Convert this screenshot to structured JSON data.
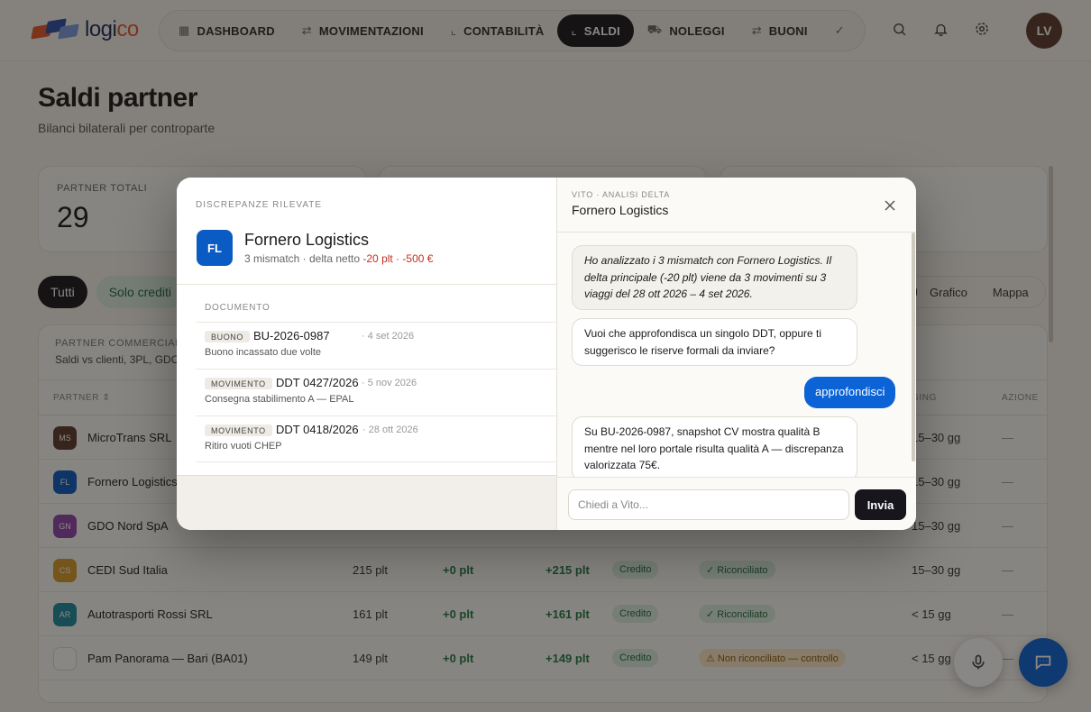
{
  "app": {
    "logo_main": "logi",
    "logo_accent": "co",
    "user_initials": "LV"
  },
  "nav": [
    {
      "label": "DASHBOARD",
      "icon": "grid-icon"
    },
    {
      "label": "MOVIMENTAZIONI",
      "icon": "swap-icon"
    },
    {
      "label": "CONTABILITÀ",
      "icon": "chart-icon"
    },
    {
      "label": "SALDI",
      "icon": "chart-icon",
      "active": true
    },
    {
      "label": "NOLEGGI",
      "icon": "truck-icon"
    },
    {
      "label": "BUONI",
      "icon": "swap-icon"
    }
  ],
  "page": {
    "title": "Saldi partner",
    "subtitle": "Bilanci bilaterali per controparte"
  },
  "stats": [
    {
      "label": "PARTNER TOTALI",
      "value": "29"
    }
  ],
  "filters": {
    "all": "Tutti",
    "credit_only": "Solo crediti",
    "view_chart": "Grafico",
    "view_map": "Mappa"
  },
  "table": {
    "title": "PARTNER COMMERCIALI",
    "subtitle": "Saldi vs clienti, 3PL, GDO",
    "col_partner": "PARTNER ⇕",
    "col_aging": "GING",
    "col_action": "AZIONE",
    "rows": [
      {
        "initials": "MS",
        "color": "#5b3b2f",
        "name": "MicroTrans SRL",
        "saldo": "",
        "delta": "",
        "netto": "",
        "type": "",
        "status": "",
        "status_kind": "",
        "aging": "15–30 gg",
        "azione": "—"
      },
      {
        "initials": "FL",
        "color": "#0a5bc4",
        "name": "Fornero Logistics",
        "saldo": "",
        "delta": "",
        "netto": "",
        "type": "",
        "status": "",
        "status_kind": "",
        "aging": "15–30 gg",
        "azione": "—"
      },
      {
        "initials": "GN",
        "color": "#8e44ad",
        "name": "GDO Nord SpA",
        "saldo": "",
        "delta": "",
        "netto": "",
        "type": "",
        "status": "",
        "status_kind": "",
        "aging": "15–30 gg",
        "azione": "—"
      },
      {
        "initials": "CS",
        "color": "#d99a2b",
        "name": "CEDI Sud Italia",
        "saldo": "215 plt",
        "delta": "+0 plt",
        "netto": "+215 plt",
        "type": "Credito",
        "status": "✓ Riconciliato",
        "status_kind": "ok",
        "aging": "15–30 gg",
        "azione": "—"
      },
      {
        "initials": "AR",
        "color": "#1a8a9c",
        "name": "Autotrasporti Rossi SRL",
        "saldo": "161 plt",
        "delta": "+0 plt",
        "netto": "+161 plt",
        "type": "Credito",
        "status": "✓ Riconciliato",
        "status_kind": "ok",
        "aging": "< 15 gg",
        "azione": "—"
      },
      {
        "initials": "",
        "color": "#ffffff",
        "name": "Pam Panorama — Bari (BA01)",
        "saldo": "149 plt",
        "delta": "+0 plt",
        "netto": "+149 plt",
        "type": "Credito",
        "status": "⚠ Non riconciliato — controllo",
        "status_kind": "warn",
        "aging": "< 15 gg",
        "azione": "—"
      }
    ]
  },
  "modal": {
    "eyebrow": "DISCREPANZE RILEVATE",
    "partner_initials": "FL",
    "partner_name": "Fornero Logistics",
    "meta_prefix": "3 mismatch · delta netto ",
    "meta_delta": "-20 plt · -500 €",
    "col_document": "DOCUMENTO",
    "documents": [
      {
        "type": "BUONO",
        "code": "BU-2026-0987",
        "date": "· 4 set 2026",
        "desc": "Buono incassato due volte"
      },
      {
        "type": "MOVIMENTO",
        "code": "DDT 0427/2026",
        "date": "· 5 nov 2026",
        "desc": "Consegna stabilimento A — EPAL"
      },
      {
        "type": "MOVIMENTO",
        "code": "DDT 0418/2026",
        "date": "· 28 ott 2026",
        "desc": "Ritiro vuoti CHEP"
      }
    ]
  },
  "assistant": {
    "eyebrow": "VITO · ANALISI DELTA",
    "title": "Fornero Logistics",
    "messages": [
      {
        "role": "assistant",
        "style": "italic",
        "text": "Ho analizzato i 3 mismatch con Fornero Logistics. Il delta principale (-20 plt) viene da 3 movimenti su 3 viaggi del 28 ott 2026 – 4 set 2026."
      },
      {
        "role": "assistant",
        "style": "normal",
        "text": "Vuoi che approfondisca un singolo DDT, oppure ti suggerisco le riserve formali da inviare?"
      },
      {
        "role": "user",
        "style": "normal",
        "text": "approfondisci"
      },
      {
        "role": "assistant",
        "style": "normal",
        "text": "Su BU-2026-0987, snapshot CV mostra qualità B mentre nel loro portale risulta qualità A — discrepanza valorizzata 75€."
      }
    ],
    "input_placeholder": "Chiedi a Vito...",
    "send_label": "Invia"
  }
}
